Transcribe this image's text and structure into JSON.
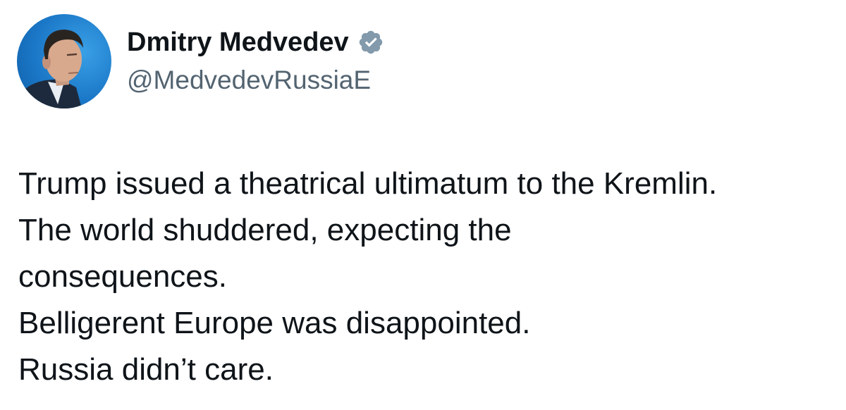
{
  "author": {
    "display_name": "Dmitry Medvedev",
    "handle": "@MedvedevRussiaE",
    "verified_icon": "verified-badge-icon",
    "verified_color": "#829aab",
    "avatar_background": "#1b78c8"
  },
  "tweet": {
    "lines": [
      "Trump issued a theatrical ultimatum to the Kremlin.",
      "The world shuddered, expecting the",
      "consequences.",
      "Belligerent Europe was disappointed.",
      "Russia didn’t care."
    ]
  }
}
